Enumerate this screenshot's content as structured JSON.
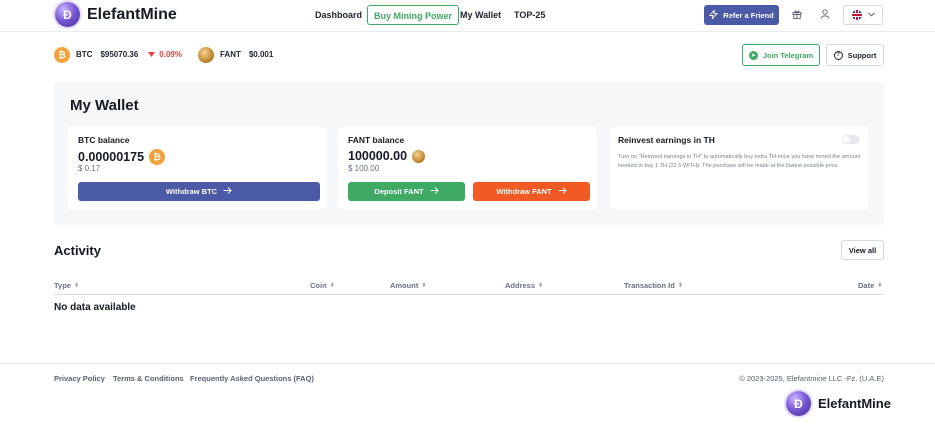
{
  "header": {
    "brand": "ElefantMine",
    "logo_glyph": "Ð",
    "nav": [
      {
        "label": "Dashboard",
        "active": false
      },
      {
        "label": "Buy Mining Power",
        "active": true
      },
      {
        "label": "My Wallet",
        "active": false
      },
      {
        "label": "TOP-25",
        "active": false
      }
    ],
    "refer_label": "Refer a Friend",
    "icons": [
      "bolt-icon",
      "gift-icon",
      "user-icon",
      "uk-flag-icon",
      "chevron-down-icon"
    ]
  },
  "ticker": {
    "btc_label": "BTC",
    "btc_price": "$95070.36",
    "btc_change": "0.09%",
    "fant_label": "FANT",
    "fant_price": "$0.001",
    "telegram_label": "Join Telegram",
    "support_label": "Support"
  },
  "wallet": {
    "title": "My Wallet",
    "btc": {
      "label": "BTC balance",
      "amount": "0.00000175",
      "usd": "$ 0.17",
      "withdraw_label": "Withdraw BTC"
    },
    "fant": {
      "label": "FANT balance",
      "amount": "100000.00",
      "usd": "$ 100.00",
      "deposit_label": "Deposit FANT",
      "withdraw_label": "Withdraw FANT"
    },
    "reinvest": {
      "label": "Reinvest earnings in TH",
      "enabled": false,
      "note": "Turn on \"Reinvest earnings in TH\" to automatically buy extra TH once you have mined the amount needed to buy 1 TH (22.5 WITH). The purchase will be made at the lowest possible price."
    }
  },
  "activity": {
    "title": "Activity",
    "view_all_label": "View all",
    "columns": [
      "Type",
      "Coin",
      "Amount",
      "Address",
      "Transaction Id",
      "Date"
    ],
    "empty_text": "No data available"
  },
  "footer": {
    "links": [
      "Privacy Policy",
      "Terms & Conditions",
      "Frequently Asked Questions (FAQ)"
    ],
    "copyright": "© 2023-2025, Elefantmine LLC -Fz. (U.A.E)",
    "brand": "ElefantMine"
  },
  "colors": {
    "accent_blue": "#4b5aa7",
    "accent_green": "#3faa63",
    "accent_orange": "#f15a24",
    "negative_red": "#e0443a",
    "btc_orange": "#f2a23a"
  }
}
